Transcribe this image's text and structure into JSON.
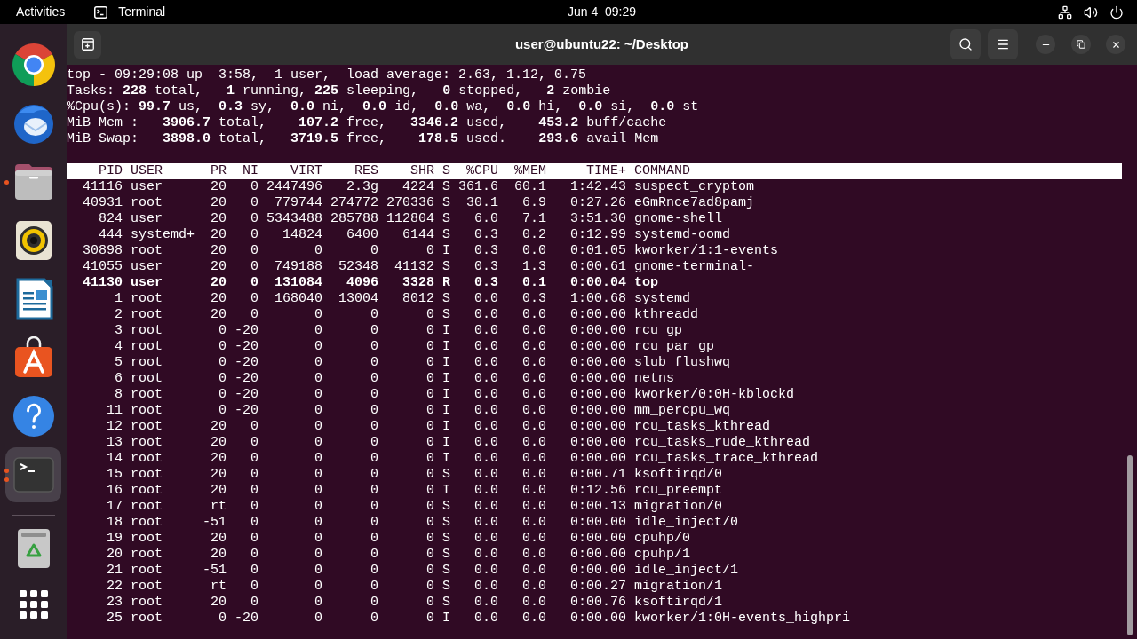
{
  "top_bar": {
    "activities": "Activities",
    "app_name": "Terminal",
    "clock": "Jun 4  09:29"
  },
  "dock": {
    "items": [
      {
        "kind": "browser",
        "running": false,
        "multiple_windows": false,
        "selected": false
      },
      {
        "kind": "mail",
        "running": false,
        "multiple_windows": false,
        "selected": false
      },
      {
        "kind": "files",
        "running": true,
        "multiple_windows": false,
        "selected": false
      },
      {
        "kind": "music",
        "running": false,
        "multiple_windows": false,
        "selected": false
      },
      {
        "kind": "writer",
        "running": false,
        "multiple_windows": false,
        "selected": false
      },
      {
        "kind": "store",
        "running": false,
        "multiple_windows": false,
        "selected": false
      },
      {
        "kind": "help",
        "running": false,
        "multiple_windows": false,
        "selected": false
      },
      {
        "kind": "terminal",
        "running": true,
        "multiple_windows": true,
        "selected": true
      }
    ],
    "utility_items": [
      {
        "kind": "trash",
        "selected": false
      },
      {
        "kind": "apps_grid",
        "selected": false
      }
    ]
  },
  "terminal": {
    "title": "user@ubuntu22: ~/Desktop",
    "summary": [
      "top - 09:29:08 up  3:58,  1 user,  load average: 2.63, 1.12, 0.75",
      "Tasks: **228** total,   **1** running, **225** sleeping,   **0** stopped,   **2** zombie",
      "%Cpu(s): **99.7** us,  **0.3** sy,  **0.0** ni,  **0.0** id,  **0.0** wa,  **0.0** hi,  **0.0** si,  **0.0** st",
      "MiB Mem :   **3906.7** total,    **107.2** free,   **3346.2** used,    **453.2** buff/cache",
      "MiB Swap:   **3898.0** total,   **3719.5** free,    **178.5** used.    **293.6** avail Mem"
    ],
    "columns": [
      "PID",
      "USER",
      "PR",
      "NI",
      "VIRT",
      "RES",
      "SHR",
      "S",
      "%CPU",
      "%MEM",
      "TIME+",
      "COMMAND"
    ],
    "rows": [
      {
        "cells": [
          "41116",
          "user",
          "20",
          "0",
          "2447496",
          "2.3g",
          "4224",
          "S",
          "361.6",
          "60.1",
          "1:42.43",
          "suspect_cryptom"
        ],
        "highlighted": false
      },
      {
        "cells": [
          "40931",
          "root",
          "20",
          "0",
          "779744",
          "274772",
          "270336",
          "S",
          "30.1",
          "6.9",
          "0:27.26",
          "eGmRnce7ad8pamj"
        ],
        "highlighted": false
      },
      {
        "cells": [
          "824",
          "user",
          "20",
          "0",
          "5343488",
          "285788",
          "112804",
          "S",
          "6.0",
          "7.1",
          "3:51.30",
          "gnome-shell"
        ],
        "highlighted": false
      },
      {
        "cells": [
          "444",
          "systemd+",
          "20",
          "0",
          "14824",
          "6400",
          "6144",
          "S",
          "0.3",
          "0.2",
          "0:12.99",
          "systemd-oomd"
        ],
        "highlighted": false
      },
      {
        "cells": [
          "30898",
          "root",
          "20",
          "0",
          "0",
          "0",
          "0",
          "I",
          "0.3",
          "0.0",
          "0:01.05",
          "kworker/1:1-events"
        ],
        "highlighted": false
      },
      {
        "cells": [
          "41055",
          "user",
          "20",
          "0",
          "749188",
          "52348",
          "41132",
          "S",
          "0.3",
          "1.3",
          "0:00.61",
          "gnome-terminal-"
        ],
        "highlighted": false
      },
      {
        "cells": [
          "41130",
          "user",
          "20",
          "0",
          "131084",
          "4096",
          "3328",
          "R",
          "0.3",
          "0.1",
          "0:00.04",
          "top"
        ],
        "highlighted": true
      },
      {
        "cells": [
          "1",
          "root",
          "20",
          "0",
          "168040",
          "13004",
          "8012",
          "S",
          "0.0",
          "0.3",
          "1:00.68",
          "systemd"
        ],
        "highlighted": false
      },
      {
        "cells": [
          "2",
          "root",
          "20",
          "0",
          "0",
          "0",
          "0",
          "S",
          "0.0",
          "0.0",
          "0:00.00",
          "kthreadd"
        ],
        "highlighted": false
      },
      {
        "cells": [
          "3",
          "root",
          "0",
          "-20",
          "0",
          "0",
          "0",
          "I",
          "0.0",
          "0.0",
          "0:00.00",
          "rcu_gp"
        ],
        "highlighted": false
      },
      {
        "cells": [
          "4",
          "root",
          "0",
          "-20",
          "0",
          "0",
          "0",
          "I",
          "0.0",
          "0.0",
          "0:00.00",
          "rcu_par_gp"
        ],
        "highlighted": false
      },
      {
        "cells": [
          "5",
          "root",
          "0",
          "-20",
          "0",
          "0",
          "0",
          "I",
          "0.0",
          "0.0",
          "0:00.00",
          "slub_flushwq"
        ],
        "highlighted": false
      },
      {
        "cells": [
          "6",
          "root",
          "0",
          "-20",
          "0",
          "0",
          "0",
          "I",
          "0.0",
          "0.0",
          "0:00.00",
          "netns"
        ],
        "highlighted": false
      },
      {
        "cells": [
          "8",
          "root",
          "0",
          "-20",
          "0",
          "0",
          "0",
          "I",
          "0.0",
          "0.0",
          "0:00.00",
          "kworker/0:0H-kblockd"
        ],
        "highlighted": false
      },
      {
        "cells": [
          "11",
          "root",
          "0",
          "-20",
          "0",
          "0",
          "0",
          "I",
          "0.0",
          "0.0",
          "0:00.00",
          "mm_percpu_wq"
        ],
        "highlighted": false
      },
      {
        "cells": [
          "12",
          "root",
          "20",
          "0",
          "0",
          "0",
          "0",
          "I",
          "0.0",
          "0.0",
          "0:00.00",
          "rcu_tasks_kthread"
        ],
        "highlighted": false
      },
      {
        "cells": [
          "13",
          "root",
          "20",
          "0",
          "0",
          "0",
          "0",
          "I",
          "0.0",
          "0.0",
          "0:00.00",
          "rcu_tasks_rude_kthread"
        ],
        "highlighted": false
      },
      {
        "cells": [
          "14",
          "root",
          "20",
          "0",
          "0",
          "0",
          "0",
          "I",
          "0.0",
          "0.0",
          "0:00.00",
          "rcu_tasks_trace_kthread"
        ],
        "highlighted": false
      },
      {
        "cells": [
          "15",
          "root",
          "20",
          "0",
          "0",
          "0",
          "0",
          "S",
          "0.0",
          "0.0",
          "0:00.71",
          "ksoftirqd/0"
        ],
        "highlighted": false
      },
      {
        "cells": [
          "16",
          "root",
          "20",
          "0",
          "0",
          "0",
          "0",
          "I",
          "0.0",
          "0.0",
          "0:12.56",
          "rcu_preempt"
        ],
        "highlighted": false
      },
      {
        "cells": [
          "17",
          "root",
          "rt",
          "0",
          "0",
          "0",
          "0",
          "S",
          "0.0",
          "0.0",
          "0:00.13",
          "migration/0"
        ],
        "highlighted": false
      },
      {
        "cells": [
          "18",
          "root",
          "-51",
          "0",
          "0",
          "0",
          "0",
          "S",
          "0.0",
          "0.0",
          "0:00.00",
          "idle_inject/0"
        ],
        "highlighted": false
      },
      {
        "cells": [
          "19",
          "root",
          "20",
          "0",
          "0",
          "0",
          "0",
          "S",
          "0.0",
          "0.0",
          "0:00.00",
          "cpuhp/0"
        ],
        "highlighted": false
      },
      {
        "cells": [
          "20",
          "root",
          "20",
          "0",
          "0",
          "0",
          "0",
          "S",
          "0.0",
          "0.0",
          "0:00.00",
          "cpuhp/1"
        ],
        "highlighted": false
      },
      {
        "cells": [
          "21",
          "root",
          "-51",
          "0",
          "0",
          "0",
          "0",
          "S",
          "0.0",
          "0.0",
          "0:00.00",
          "idle_inject/1"
        ],
        "highlighted": false
      },
      {
        "cells": [
          "22",
          "root",
          "rt",
          "0",
          "0",
          "0",
          "0",
          "S",
          "0.0",
          "0.0",
          "0:00.27",
          "migration/1"
        ],
        "highlighted": false
      },
      {
        "cells": [
          "23",
          "root",
          "20",
          "0",
          "0",
          "0",
          "0",
          "S",
          "0.0",
          "0.0",
          "0:00.76",
          "ksoftirqd/1"
        ],
        "highlighted": false
      },
      {
        "cells": [
          "25",
          "root",
          "0",
          "-20",
          "0",
          "0",
          "0",
          "I",
          "0.0",
          "0.0",
          "0:00.00",
          "kworker/1:0H-events_highpri"
        ],
        "highlighted": false
      }
    ]
  }
}
